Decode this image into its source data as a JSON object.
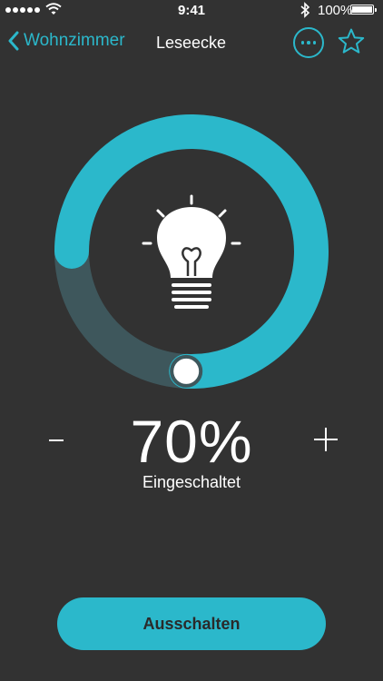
{
  "status_bar": {
    "time": "9:41",
    "battery": "100%"
  },
  "nav": {
    "back_label": "Wohnzimmer",
    "title": "Leseecke"
  },
  "light": {
    "brightness_percent": 70,
    "brightness_label": "70%",
    "state_label": "Eingeschaltet",
    "decrease_label": "-",
    "increase_label": "+"
  },
  "actions": {
    "off_label": "Ausschalten"
  },
  "colors": {
    "background": "#323232",
    "accent": "#2bb8cb",
    "track": "#3e575c"
  },
  "icons": [
    "chevron-left-icon",
    "more-icon",
    "star-icon",
    "lightbulb-icon",
    "wifi-icon",
    "bluetooth-icon",
    "battery-icon"
  ]
}
